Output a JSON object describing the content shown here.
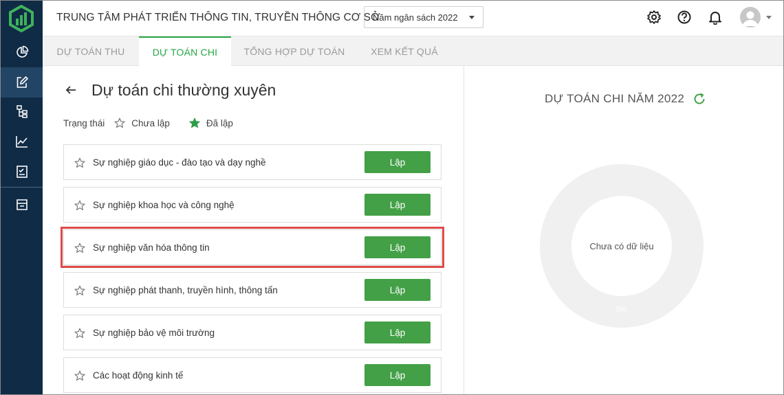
{
  "header": {
    "org_title": "TRUNG TÂM PHÁT TRIỂN THÔNG TIN, TRUYỀN THÔNG CƠ SỞ",
    "year_select": "Năm ngân sách 2022"
  },
  "sidebar": {
    "items": [
      {
        "icon": "pie-chart-icon"
      },
      {
        "icon": "edit-icon",
        "active": true
      },
      {
        "icon": "org-chart-icon"
      },
      {
        "icon": "line-chart-icon"
      },
      {
        "icon": "report-icon"
      },
      {
        "icon": "inbox-icon"
      }
    ]
  },
  "tabs": [
    {
      "label": "DỰ TOÁN THU"
    },
    {
      "label": "DỰ TOÁN CHI",
      "active": true
    },
    {
      "label": "TỔNG HỢP DỰ TOÁN"
    },
    {
      "label": "XEM KẾT QUẢ"
    }
  ],
  "main": {
    "page_title": "Dự toán chi thường xuyên",
    "status": {
      "label": "Trạng thái",
      "not_done": "Chưa lập",
      "done": "Đã lập"
    },
    "items": [
      {
        "name": "Sự nghiệp giáo dục - đào tạo và dạy nghề",
        "button": "Lập"
      },
      {
        "name": "Sự nghiệp khoa học và công nghệ",
        "button": "Lập"
      },
      {
        "name": "Sự nghiệp văn hóa thông tin",
        "button": "Lập"
      },
      {
        "name": "Sự nghiệp phát thanh, truyền hình, thông tấn",
        "button": "Lập"
      },
      {
        "name": "Sự nghiệp bảo vệ môi trường",
        "button": "Lập"
      },
      {
        "name": "Các hoạt động kinh tế",
        "button": "Lập"
      }
    ]
  },
  "right_panel": {
    "title": "DỰ TOÁN CHI NĂM 2022",
    "empty_text": "Chưa có dữ liệu",
    "percent": "0%"
  },
  "colors": {
    "sidebar_bg": "#0f2b46",
    "accent_green": "#43a047",
    "tab_active": "#27a745",
    "highlight_red": "#e04a4a"
  }
}
